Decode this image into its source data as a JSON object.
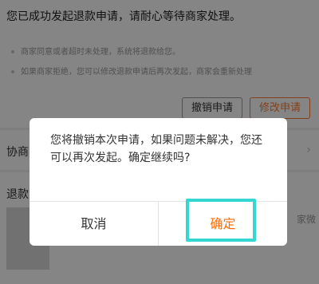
{
  "status": {
    "title": "您已成功发起退款申请，请耐心等待商家处理。",
    "tips": [
      "商家同意或者超时未处理，系统将退款给您。",
      "如果商家拒绝，您可以修改退款申请后再次发起，商家会重新处理"
    ],
    "cancel_button": "撤销申请",
    "modify_button": "修改申请"
  },
  "rows": {
    "negotiate_label": "协商",
    "refund_label": "退款",
    "refund_side_text": "家微"
  },
  "dialog": {
    "message": "您将撤销本次申请，如果问题未解决，您还可以再次发起。确定继续吗?",
    "cancel_label": "取消",
    "confirm_label": "确定"
  },
  "colors": {
    "accent": "#ff7a2f",
    "confirm_text": "#ff6a00",
    "highlight": "#35d8d0"
  }
}
